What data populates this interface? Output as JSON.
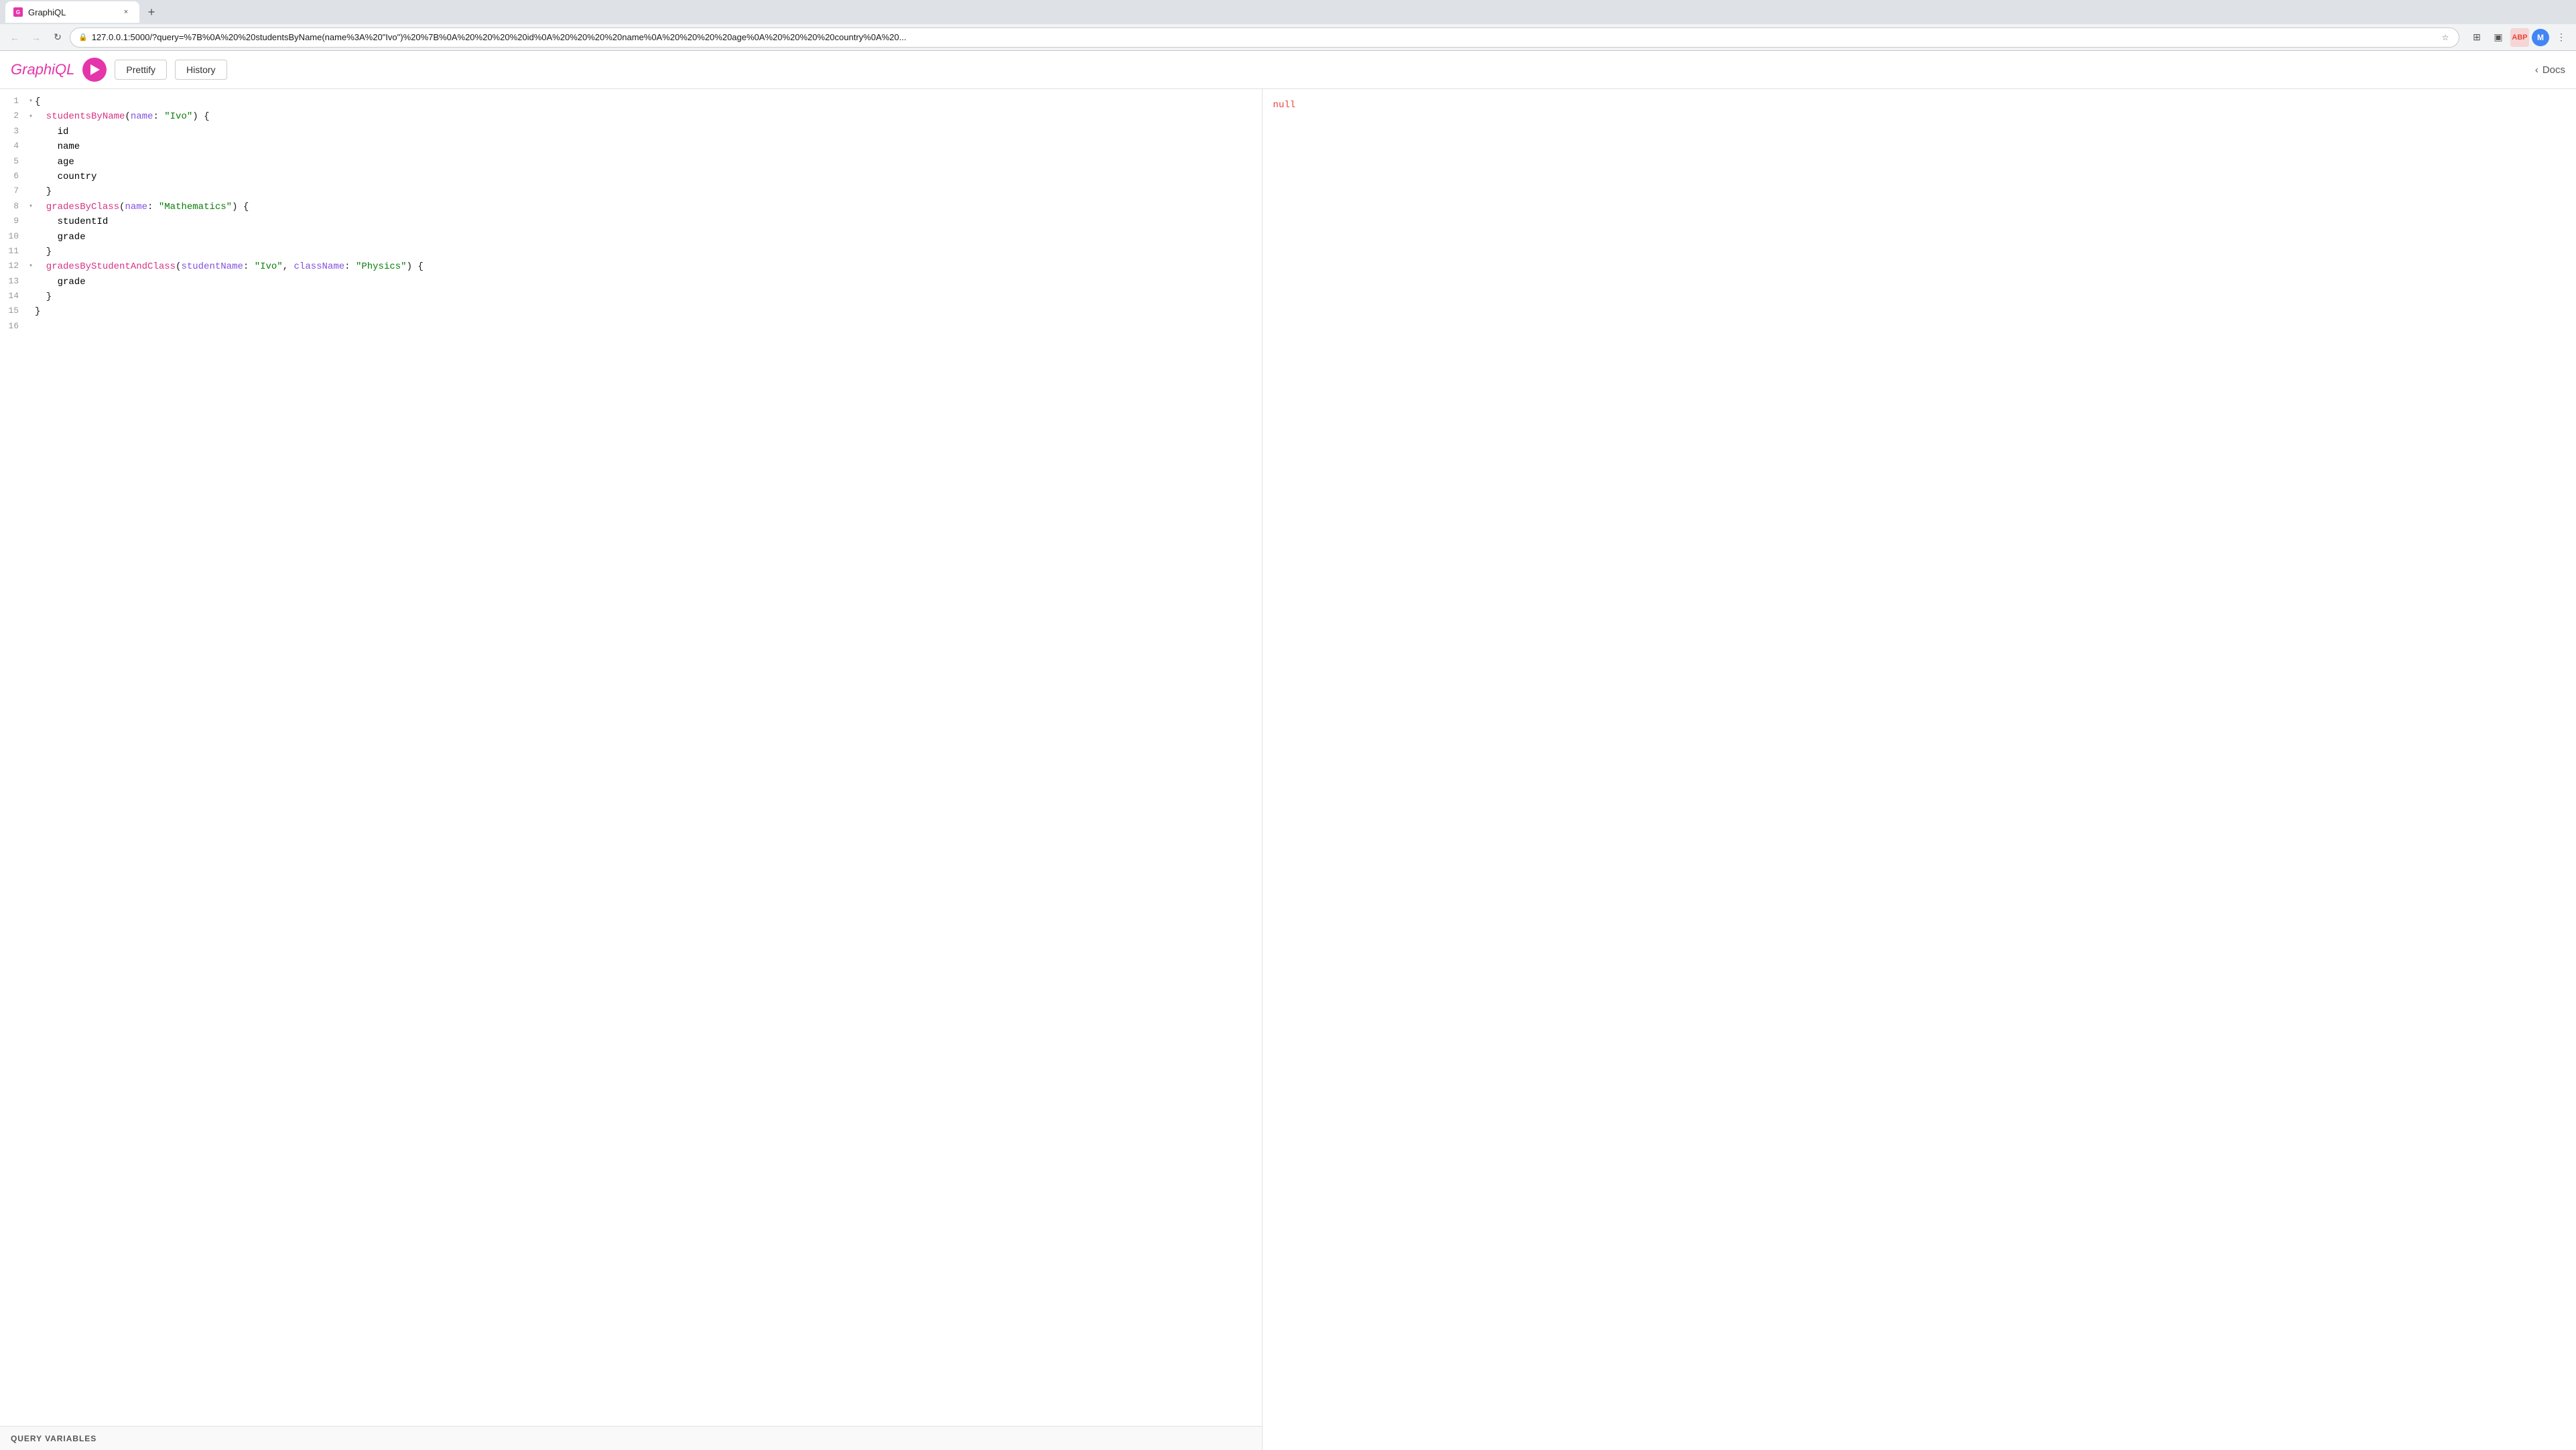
{
  "browser": {
    "tab": {
      "favicon_text": "G",
      "title": "GraphiQL",
      "close_icon": "×"
    },
    "new_tab_icon": "+",
    "nav": {
      "back_icon": "←",
      "forward_icon": "→",
      "reload_icon": "↻",
      "address": "127.0.0.1:5000/?query=%7B%0A%20%20studentsByName(name%3A%20\"Ivo\")%20%7B%0A%20%20%20%20id%0A%20%20%20%20name%0A%20%20%20%20age%0A%20%20%20%20country%0A%20...",
      "bookmark_icon": "☆",
      "extensions_icon": "⊞",
      "wallet_icon": "▣",
      "adblocker_text": "ABP",
      "profile_initial": "M"
    }
  },
  "app": {
    "logo": {
      "prefix": "Graph",
      "italic": "i",
      "suffix": "QL"
    },
    "run_button_label": "Run",
    "prettify_label": "Prettify",
    "history_label": "History",
    "docs_label": "Docs"
  },
  "editor": {
    "lines": [
      {
        "num": "1",
        "gutter": "▾",
        "content": [
          {
            "type": "brace",
            "text": "{"
          }
        ]
      },
      {
        "num": "2",
        "gutter": "▾",
        "content": [
          {
            "type": "func",
            "text": "  studentsByName"
          },
          {
            "type": "plain",
            "text": "("
          },
          {
            "type": "param",
            "text": "name"
          },
          {
            "type": "plain",
            "text": ": "
          },
          {
            "type": "str",
            "text": "\"Ivo\""
          },
          {
            "type": "plain",
            "text": ") {"
          }
        ]
      },
      {
        "num": "3",
        "gutter": "",
        "content": [
          {
            "type": "field",
            "text": "    id"
          }
        ]
      },
      {
        "num": "4",
        "gutter": "",
        "content": [
          {
            "type": "field",
            "text": "    name"
          }
        ]
      },
      {
        "num": "5",
        "gutter": "",
        "content": [
          {
            "type": "field",
            "text": "    age"
          }
        ]
      },
      {
        "num": "6",
        "gutter": "",
        "content": [
          {
            "type": "field",
            "text": "    country"
          }
        ]
      },
      {
        "num": "7",
        "gutter": "",
        "content": [
          {
            "type": "brace",
            "text": "  }"
          }
        ]
      },
      {
        "num": "8",
        "gutter": "▾",
        "content": [
          {
            "type": "func",
            "text": "  gradesByClass"
          },
          {
            "type": "plain",
            "text": "("
          },
          {
            "type": "param",
            "text": "name"
          },
          {
            "type": "plain",
            "text": ": "
          },
          {
            "type": "str",
            "text": "\"Mathematics\""
          },
          {
            "type": "plain",
            "text": ") {"
          }
        ]
      },
      {
        "num": "9",
        "gutter": "",
        "content": [
          {
            "type": "field",
            "text": "    studentId"
          }
        ]
      },
      {
        "num": "10",
        "gutter": "",
        "content": [
          {
            "type": "field",
            "text": "    grade"
          }
        ]
      },
      {
        "num": "11",
        "gutter": "",
        "content": [
          {
            "type": "brace",
            "text": "  }"
          }
        ]
      },
      {
        "num": "12",
        "gutter": "▾",
        "content": [
          {
            "type": "func",
            "text": "  gradesByStudentAndClass"
          },
          {
            "type": "plain",
            "text": "("
          },
          {
            "type": "param",
            "text": "studentName"
          },
          {
            "type": "plain",
            "text": ": "
          },
          {
            "type": "str",
            "text": "\"Ivo\""
          },
          {
            "type": "plain",
            "text": ", "
          },
          {
            "type": "param",
            "text": "className"
          },
          {
            "type": "plain",
            "text": ": "
          },
          {
            "type": "str",
            "text": "\"Physics\""
          },
          {
            "type": "plain",
            "text": ") {"
          }
        ]
      },
      {
        "num": "13",
        "gutter": "",
        "content": [
          {
            "type": "field",
            "text": "    grade"
          }
        ]
      },
      {
        "num": "14",
        "gutter": "",
        "content": [
          {
            "type": "brace",
            "text": "  }"
          }
        ]
      },
      {
        "num": "15",
        "gutter": "",
        "content": [
          {
            "type": "brace",
            "text": "}"
          }
        ]
      },
      {
        "num": "16",
        "gutter": "",
        "content": []
      }
    ]
  },
  "result": {
    "value": "null"
  },
  "query_variables": {
    "label": "QUERY VARIABLES"
  }
}
